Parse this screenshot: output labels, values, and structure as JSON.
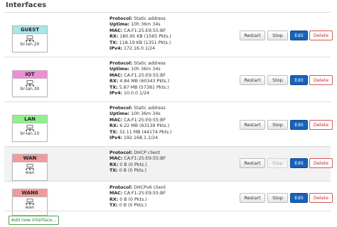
{
  "page": {
    "title": "Interfaces"
  },
  "buttons": {
    "restart": "Restart",
    "stop": "Stop",
    "edit": "Edit",
    "delete": "Delete",
    "add": "Add new interface..."
  },
  "labels": {
    "protocol": "Protocol:",
    "uptime": "Uptime:",
    "mac": "MAC:",
    "rx": "RX:",
    "tx": "TX:",
    "ipv4": "IPv4:"
  },
  "interfaces": [
    {
      "name": "GUEST",
      "color": "#a6e7ec",
      "device": "br-lan.20",
      "protocol": "Static address",
      "uptime": "10h 36m 34s",
      "mac": "CA:F1:25:E9:55:BF",
      "rx": "180.95 KB (1565 Pkts.)",
      "tx": "118.19 KB (1351 Pkts.)",
      "ipv4": "172.16.0.1/24",
      "stop_enabled": true
    },
    {
      "name": "IOT",
      "color": "#f28ad6",
      "device": "br-lan.30",
      "protocol": "Static address",
      "uptime": "10h 36m 34s",
      "mac": "CA:F1:25:E9:55:BF",
      "rx": "4.84 MB (60343 Pkts.)",
      "tx": "5.87 MB (57381 Pkts.)",
      "ipv4": "10.0.0.1/24",
      "stop_enabled": true
    },
    {
      "name": "LAN",
      "color": "#90f08d",
      "device": "br-lan.10",
      "protocol": "Static address",
      "uptime": "10h 36m 34s",
      "mac": "CA:F1:25:E9:55:BF",
      "rx": "6.22 MB (63139 Pkts.)",
      "tx": "32.11 MB (44174 Pkts.)",
      "ipv4": "192.168.1.1/24",
      "stop_enabled": true
    },
    {
      "name": "WAN",
      "color": "#f09a9a",
      "device": "wan",
      "protocol": "DHCP client",
      "uptime": "",
      "mac": "CA:F1:25:E9:55:BF",
      "rx": "0 B (0 Pkts.)",
      "tx": "0 B (0 Pkts.)",
      "ipv4": "",
      "stop_enabled": false
    },
    {
      "name": "WAN6",
      "color": "#f09a9a",
      "device": "wan",
      "protocol": "DHCPv6 client",
      "uptime": "",
      "mac": "CA:F1:25:E9:55:BF",
      "rx": "0 B (0 Pkts.)",
      "tx": "0 B (0 Pkts.)",
      "ipv4": "",
      "stop_enabled": true
    }
  ]
}
